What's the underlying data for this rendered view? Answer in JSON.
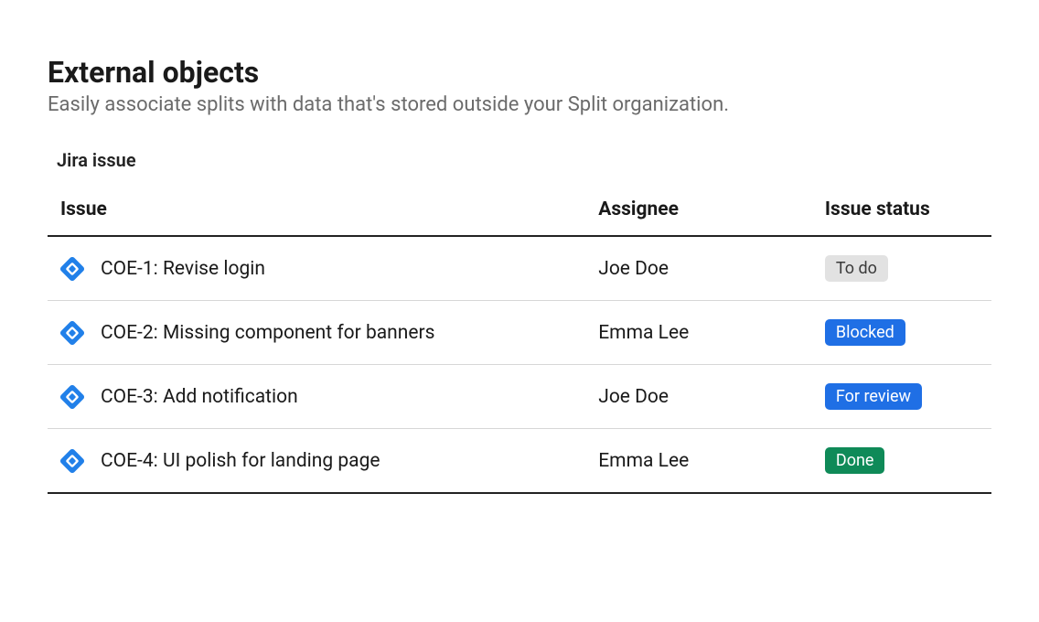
{
  "header": {
    "title": "External objects",
    "subtitle": "Easily associate splits with data that's stored outside your Split organization."
  },
  "section": {
    "label": "Jira issue"
  },
  "table": {
    "columns": {
      "issue": "Issue",
      "assignee": "Assignee",
      "status": "Issue status"
    },
    "rows": [
      {
        "issue": "COE-1: Revise login",
        "assignee": "Joe Doe",
        "status": {
          "label": "To do",
          "kind": "todo"
        }
      },
      {
        "issue": "COE-2: Missing component for banners",
        "assignee": "Emma Lee",
        "status": {
          "label": "Blocked",
          "kind": "blocked"
        }
      },
      {
        "issue": "COE-3: Add notification",
        "assignee": "Joe Doe",
        "status": {
          "label": "For review",
          "kind": "forreview"
        }
      },
      {
        "issue": "COE-4: UI polish for landing page",
        "assignee": "Emma Lee",
        "status": {
          "label": "Done",
          "kind": "done"
        }
      }
    ]
  }
}
